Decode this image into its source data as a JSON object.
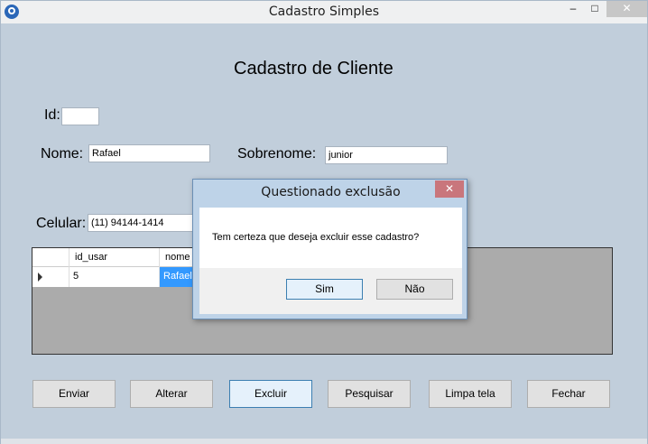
{
  "window": {
    "title": "Cadastro Simples",
    "minimize_glyph": "–",
    "maximize_glyph": "□",
    "close_glyph": "✕"
  },
  "form": {
    "heading": "Cadastro de Cliente",
    "id_label": "Id:",
    "id_value": "",
    "nome_label": "Nome:",
    "nome_value": "Rafael",
    "sobrenome_label": "Sobrenome:",
    "sobrenome_value": "junior",
    "celular_label": "Celular:",
    "celular_value": "(11) 94144-1414"
  },
  "grid": {
    "columns": [
      "id_usar",
      "nome"
    ],
    "rows": [
      [
        "5",
        "Rafael"
      ]
    ]
  },
  "buttons": {
    "enviar": "Enviar",
    "alterar": "Alterar",
    "excluir": "Excluir",
    "pesquisar": "Pesquisar",
    "limpa": "Limpa tela",
    "fechar": "Fechar"
  },
  "dialog": {
    "title": "Questionado exclusão",
    "close_glyph": "✕",
    "message": "Tem certeza que deseja excluir esse cadastro?",
    "yes": "Sim",
    "no": "Não"
  }
}
